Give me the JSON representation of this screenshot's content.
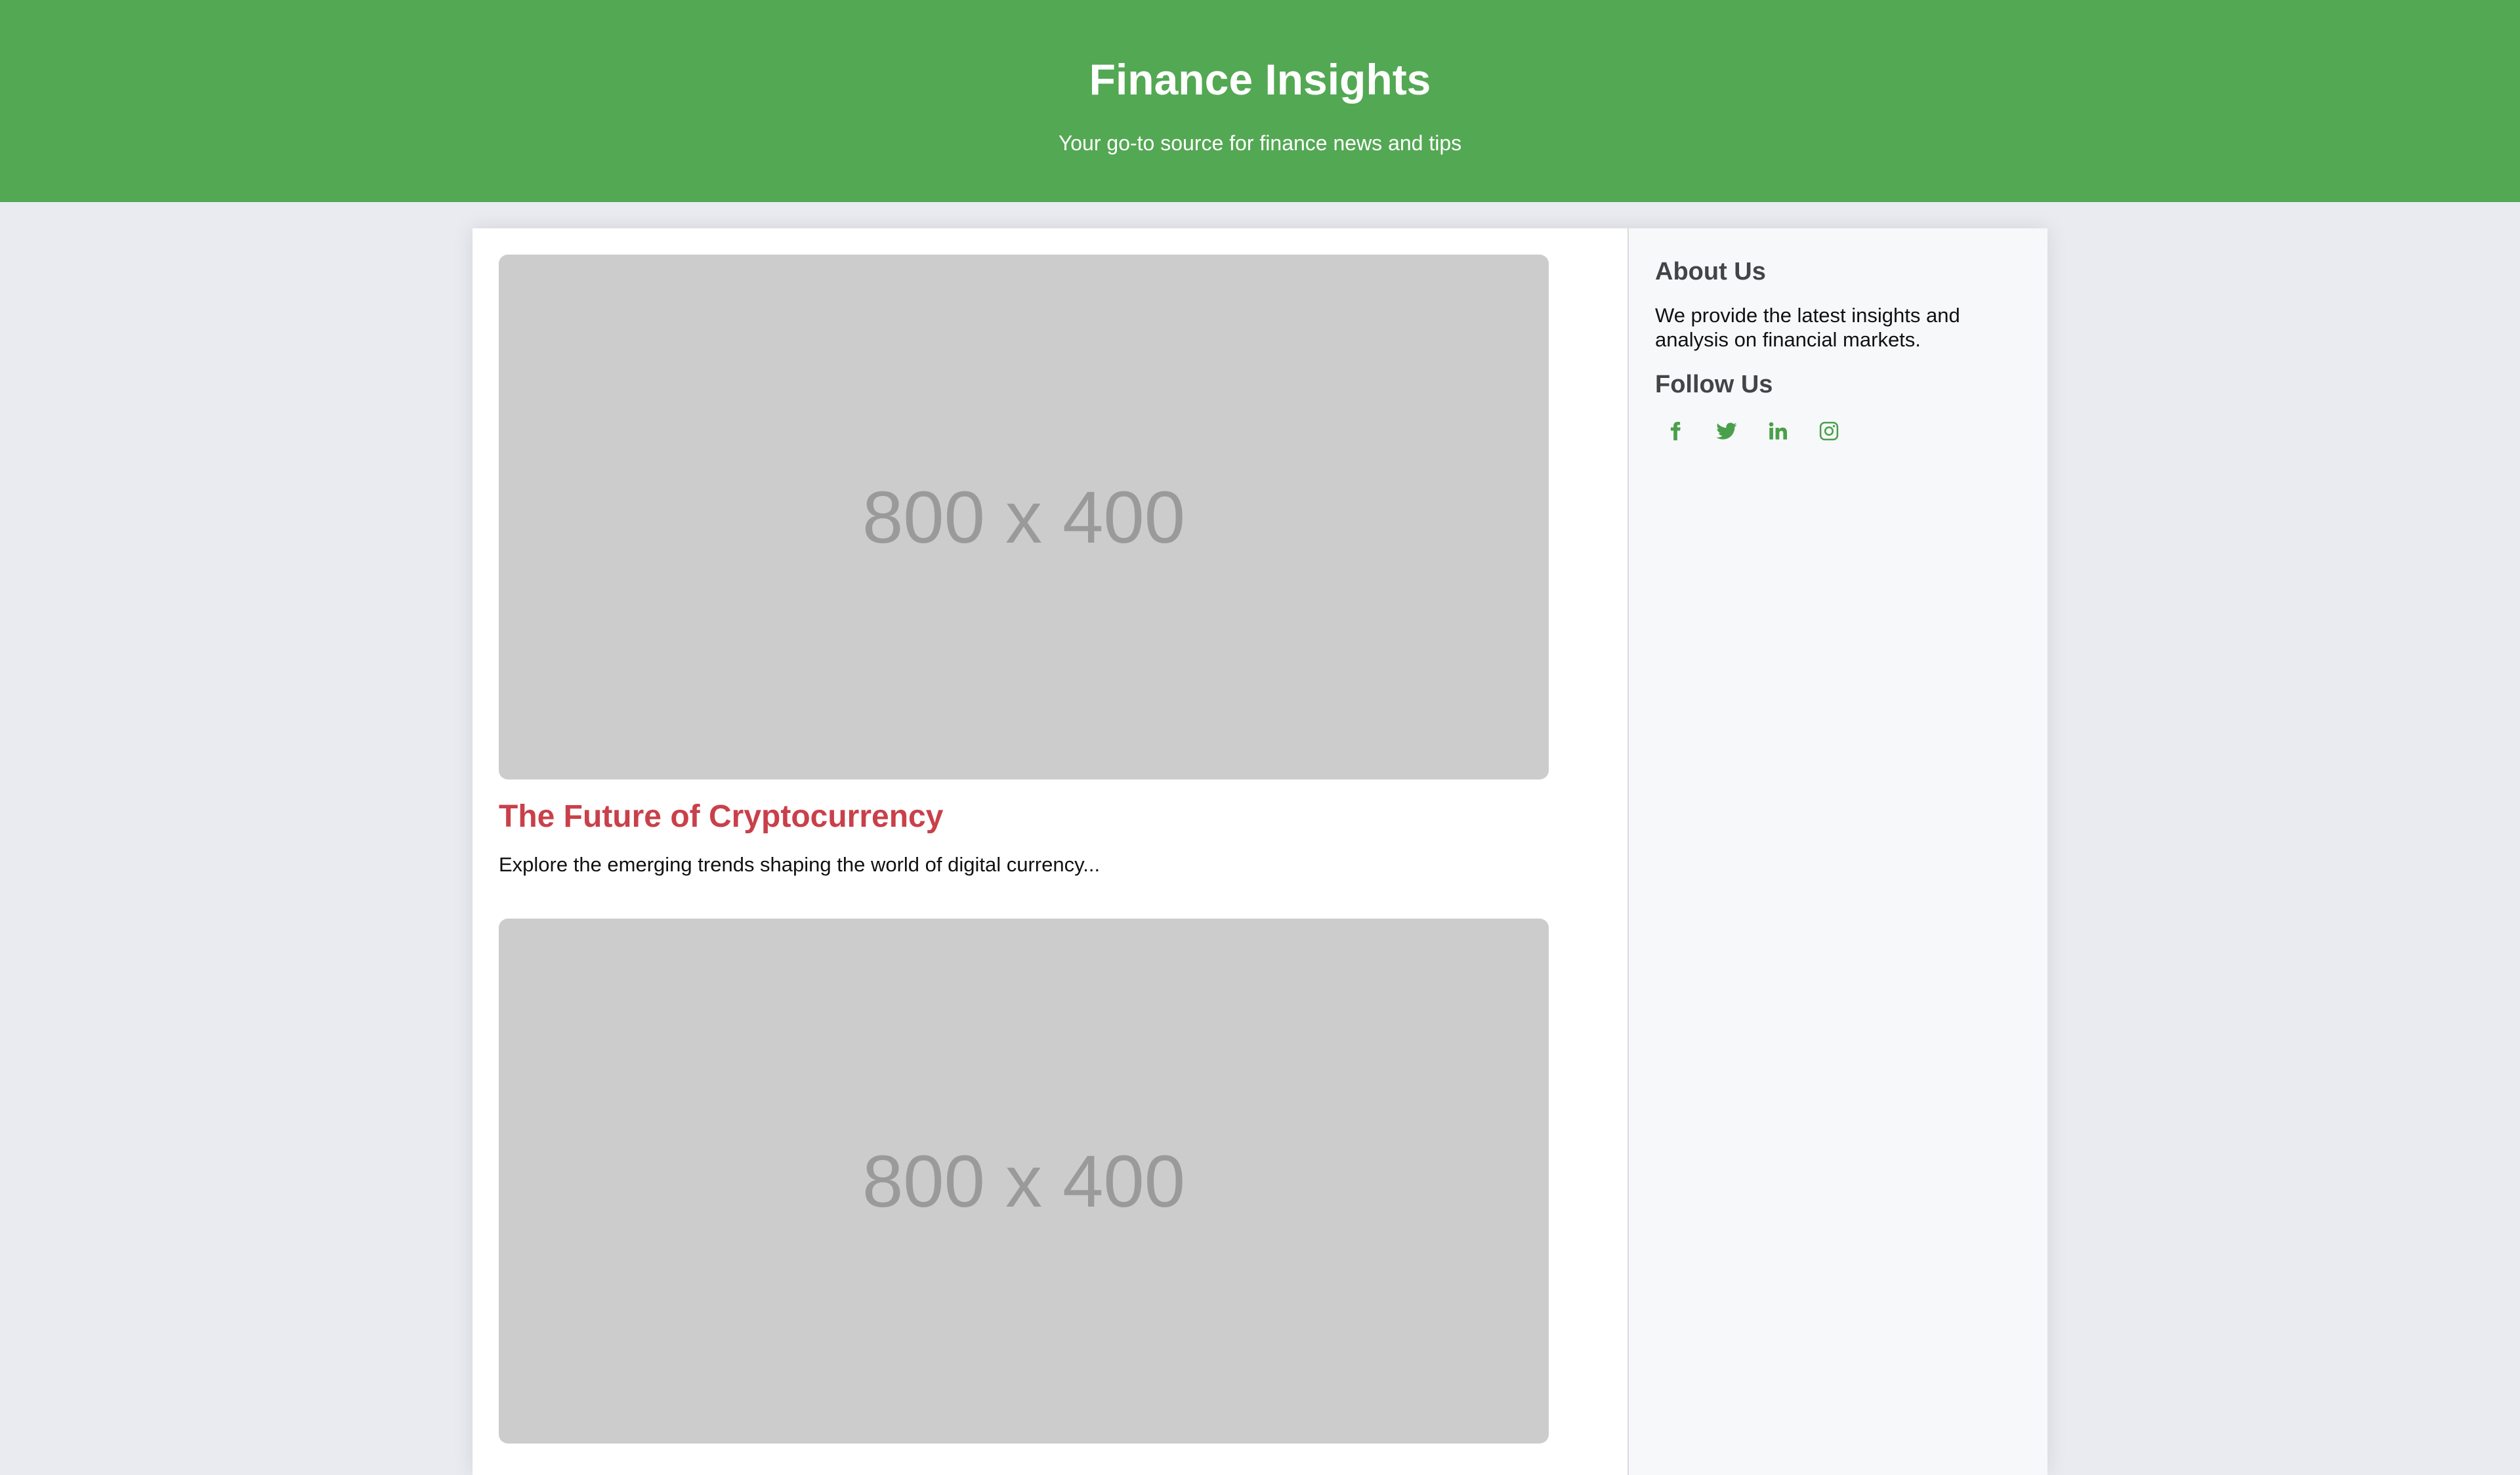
{
  "header": {
    "title": "Finance Insights",
    "tagline": "Your go-to source for finance news and tips"
  },
  "articles": [
    {
      "image_label": "800 x 400",
      "title": "The Future of Cryptocurrency",
      "excerpt": "Explore the emerging trends shaping the world of digital currency..."
    },
    {
      "image_label": "800 x 400"
    }
  ],
  "sidebar": {
    "about_heading": "About Us",
    "about_text": "We provide the latest insights and analysis on financial markets.",
    "follow_heading": "Follow Us",
    "social_icons": [
      "facebook-icon",
      "twitter-icon",
      "linkedin-icon",
      "instagram-icon"
    ]
  },
  "colors": {
    "header_bg": "#53a853",
    "article_title": "#c9404a",
    "icon_accent": "#4aa04a",
    "page_bg": "#e9ebf0"
  }
}
